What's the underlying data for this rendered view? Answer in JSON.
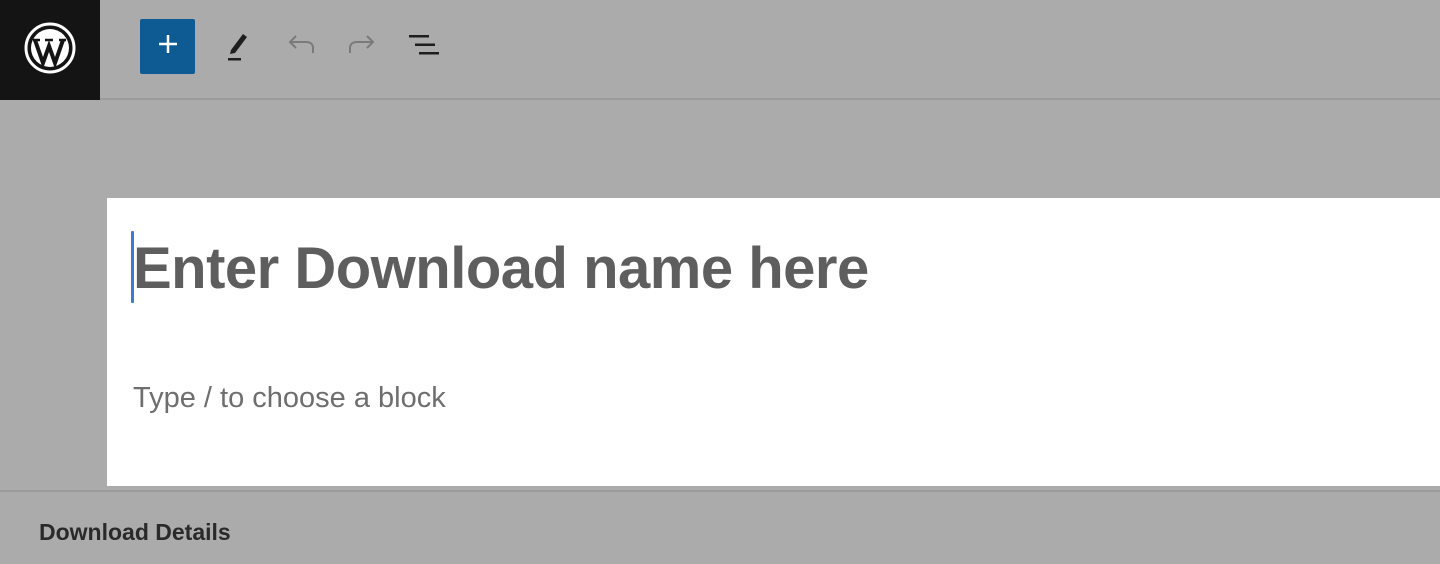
{
  "header": {
    "logo_icon": "wordpress-logo-icon",
    "toolbar": {
      "add_block_icon": "plus-icon",
      "tools_icon": "pencil-icon",
      "undo_icon": "undo-icon",
      "redo_icon": "redo-icon",
      "document_overview_icon": "list-view-icon"
    }
  },
  "editor": {
    "title_placeholder": "Enter Download name here",
    "block_placeholder": "Type / to choose a block"
  },
  "details_panel": {
    "title": "Download Details"
  },
  "colors": {
    "accent": "#0e5a92",
    "caret": "#3a7bd5",
    "logo_background": "#141414",
    "overlay": "#ababab"
  }
}
